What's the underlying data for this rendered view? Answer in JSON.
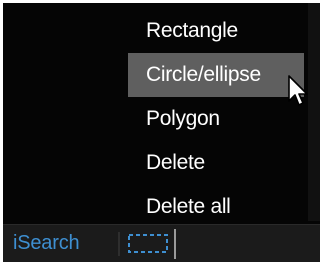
{
  "context_menu": {
    "items": [
      {
        "label": "Rectangle",
        "highlighted": false
      },
      {
        "label": "Circle/ellipse",
        "highlighted": true
      },
      {
        "label": "Polygon",
        "highlighted": false
      },
      {
        "label": "Delete",
        "highlighted": false
      },
      {
        "label": "Delete all",
        "highlighted": false
      }
    ]
  },
  "statusbar": {
    "search_label": "iSearch",
    "tool_icon": "dashed-rectangle-selection-icon"
  },
  "colors": {
    "viewport_bg": "#050505",
    "menu_highlight": "#5f5f5f",
    "menu_text": "#ffffff",
    "statusbar_bg": "#1b1b1b",
    "search_label": "#3e8fd1",
    "tool_icon": "#3e8fd1"
  }
}
